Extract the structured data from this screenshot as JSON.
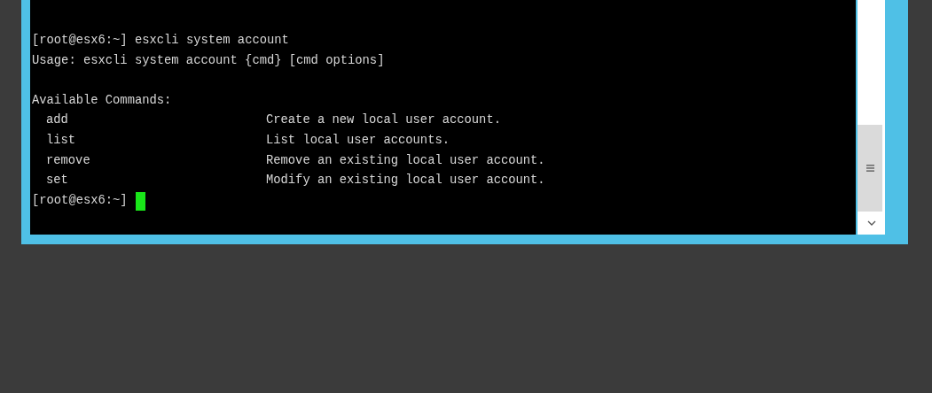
{
  "terminal": {
    "lines": [
      {
        "kind": "prompt",
        "prompt": "[root@esx6:~]",
        "command": "esxcli system account",
        "cursor": false
      },
      {
        "kind": "text",
        "text": "Usage: esxcli system account {cmd} [cmd options]"
      },
      {
        "kind": "blank"
      },
      {
        "kind": "text",
        "text": "Available Commands:"
      },
      {
        "kind": "entry",
        "name": "add",
        "description": "Create a new local user account."
      },
      {
        "kind": "entry",
        "name": "list",
        "description": "List local user accounts."
      },
      {
        "kind": "entry",
        "name": "remove",
        "description": "Remove an existing local user account."
      },
      {
        "kind": "entry",
        "name": "set",
        "description": "Modify an existing local user account."
      },
      {
        "kind": "prompt",
        "prompt": "[root@esx6:~]",
        "cursor": true
      }
    ]
  }
}
